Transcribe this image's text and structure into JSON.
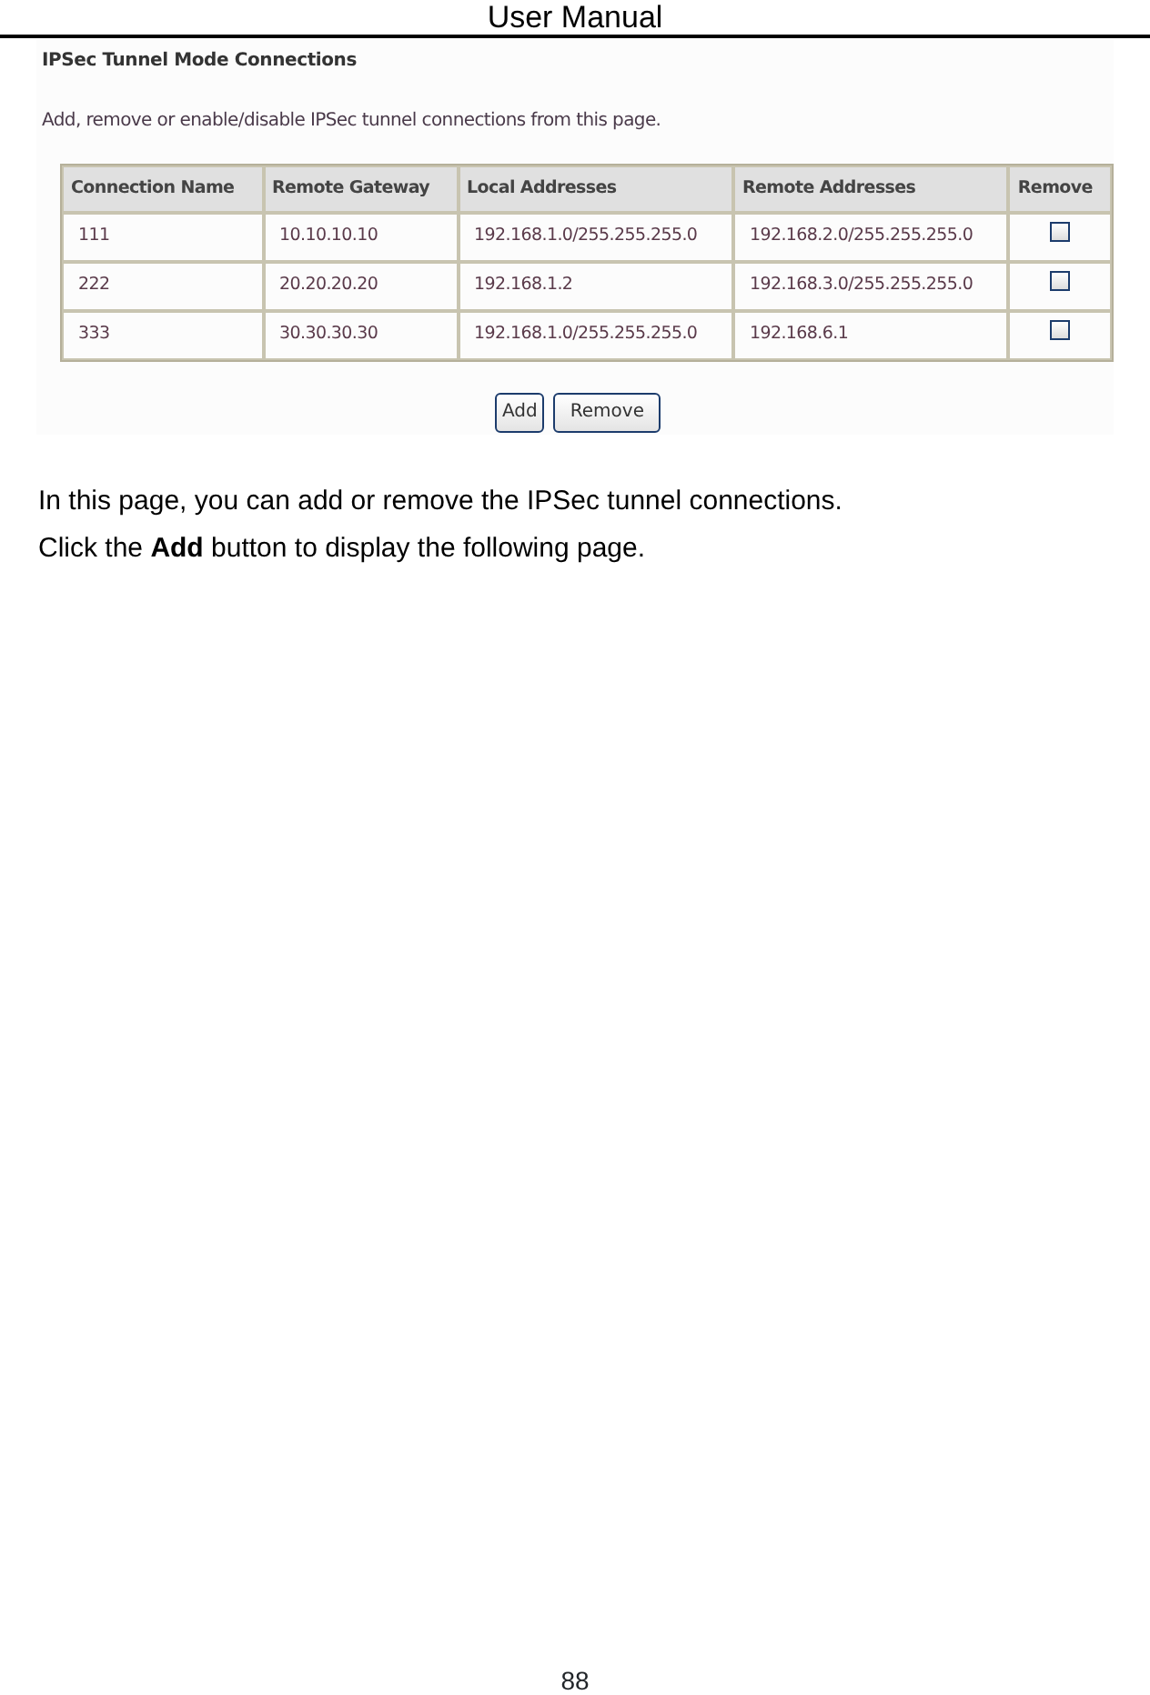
{
  "header": {
    "title": "User Manual"
  },
  "screenshot": {
    "title": "IPSec Tunnel Mode Connections",
    "description": "Add, remove or enable/disable IPSec tunnel connections from this page.",
    "table": {
      "columns": [
        "Connection Name",
        "Remote Gateway",
        "Local Addresses",
        "Remote Addresses",
        "Remove"
      ],
      "rows": [
        {
          "cells": [
            "111",
            "10.10.10.10",
            "192.168.1.0/255.255.255.0",
            "192.168.2.0/255.255.255.0"
          ],
          "remove_checked": false
        },
        {
          "cells": [
            "222",
            "20.20.20.20",
            "192.168.1.2",
            "192.168.3.0/255.255.255.0"
          ],
          "remove_checked": false
        },
        {
          "cells": [
            "333",
            "30.30.30.30",
            "192.168.1.0/255.255.255.0",
            "192.168.6.1"
          ],
          "remove_checked": false
        }
      ]
    },
    "buttons": [
      "Add",
      "Remove"
    ]
  },
  "paragraphs": [
    "In this page, you can add or remove the IPSec tunnel connections.",
    "Click the **Add** button to display the following page."
  ],
  "footer": {
    "page_number": "88"
  }
}
